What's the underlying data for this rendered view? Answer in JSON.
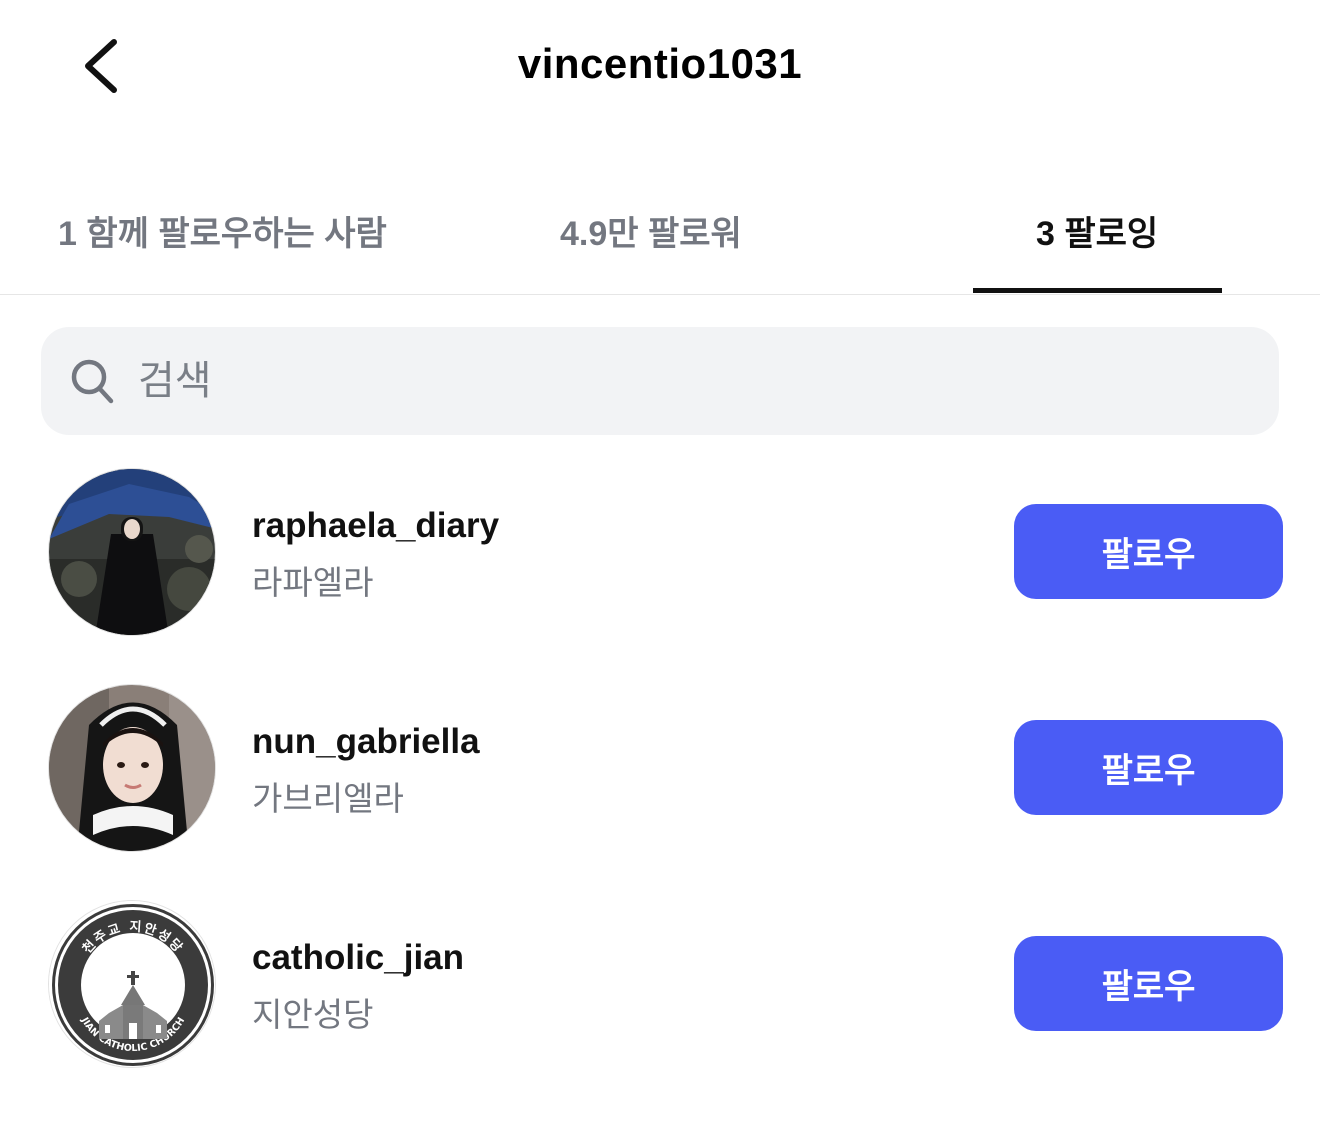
{
  "header": {
    "back_icon": "chevron-left-icon",
    "title": "vincentio1031"
  },
  "tabs": [
    {
      "label": "1 함께 팔로우하는 사람",
      "active": false
    },
    {
      "label": "4.9만 팔로워",
      "active": false
    },
    {
      "label": "3 팔로잉",
      "active": true
    }
  ],
  "search": {
    "placeholder": "검색",
    "icon": "search-icon"
  },
  "following": [
    {
      "username": "raphaela_diary",
      "fullname": "라파엘라",
      "button": "팔로우"
    },
    {
      "username": "nun_gabriella",
      "fullname": "가브리엘라",
      "button": "팔로우"
    },
    {
      "username": "catholic_jian",
      "fullname": "지안성당",
      "button": "팔로우"
    }
  ],
  "logo": {
    "top_text": "천주교 지안성당",
    "bottom_text": "JIAN CATHOLIC CHURCH"
  },
  "colors": {
    "accent": "#4a5cf5",
    "muted_text": "#737780",
    "search_bg": "#f2f3f5"
  }
}
